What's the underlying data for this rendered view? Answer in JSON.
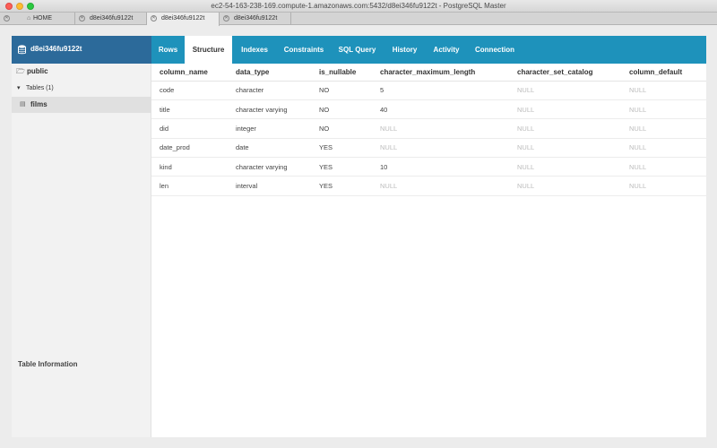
{
  "window": {
    "title": "ec2-54-163-238-169.compute-1.amazonaws.com:5432/d8ei346fu9122t - PostgreSQL Master"
  },
  "tabs": [
    {
      "label": "HOME"
    },
    {
      "label": "d8ei346fu9122t"
    },
    {
      "label": "d8ei346fu9122t"
    },
    {
      "label": "d8ei346fu9122t"
    }
  ],
  "sidebar": {
    "database": "d8ei346fu9122t",
    "schema": "public",
    "tables_label": "Tables (1)",
    "table": "films",
    "info_label": "Table Information"
  },
  "nav": [
    {
      "label": "Rows"
    },
    {
      "label": "Structure"
    },
    {
      "label": "Indexes"
    },
    {
      "label": "Constraints"
    },
    {
      "label": "SQL Query"
    },
    {
      "label": "History"
    },
    {
      "label": "Activity"
    },
    {
      "label": "Connection"
    }
  ],
  "structure": {
    "headers": [
      "column_name",
      "data_type",
      "is_nullable",
      "character_maximum_length",
      "character_set_catalog",
      "column_default"
    ],
    "rows": [
      [
        "code",
        "character",
        "NO",
        "5",
        "NULL",
        "NULL"
      ],
      [
        "title",
        "character varying",
        "NO",
        "40",
        "NULL",
        "NULL"
      ],
      [
        "did",
        "integer",
        "NO",
        "NULL",
        "NULL",
        "NULL"
      ],
      [
        "date_prod",
        "date",
        "YES",
        "NULL",
        "NULL",
        "NULL"
      ],
      [
        "kind",
        "character varying",
        "YES",
        "10",
        "NULL",
        "NULL"
      ],
      [
        "len",
        "interval",
        "YES",
        "NULL",
        "NULL",
        "NULL"
      ]
    ]
  },
  "colors": {
    "nav_bg": "#1e92bb",
    "db_header_bg": "#2c6a9a",
    "null_text": "#bbbbbb"
  }
}
